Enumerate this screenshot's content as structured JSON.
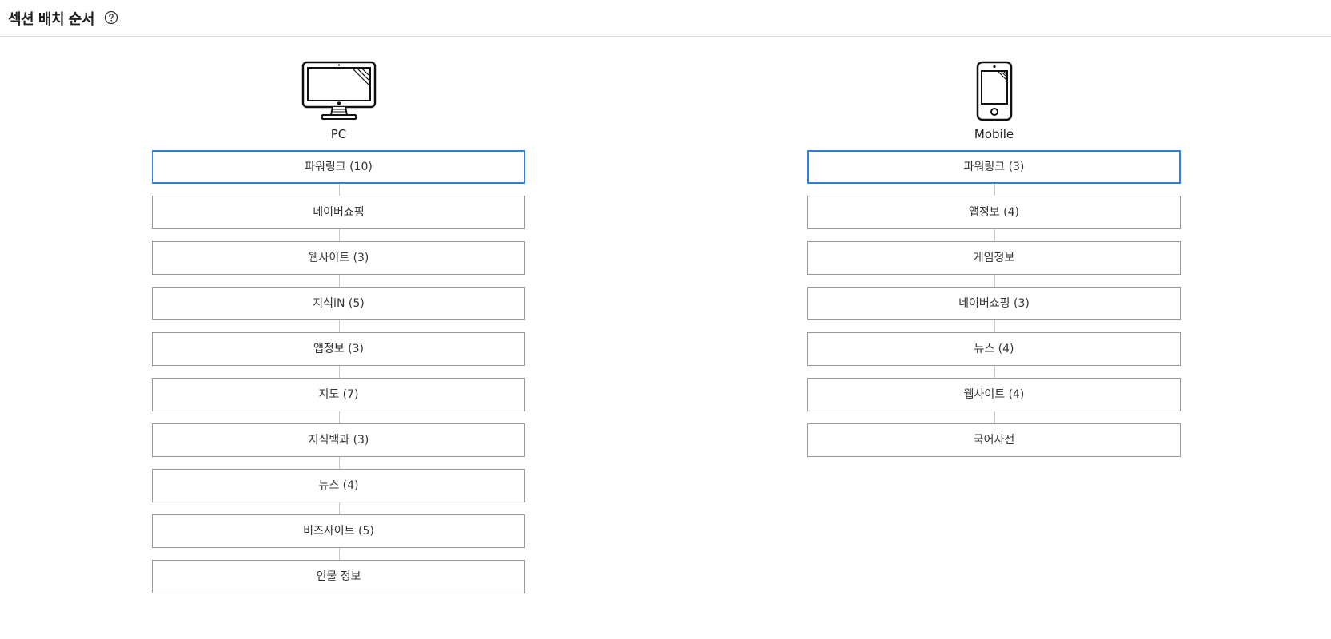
{
  "header": {
    "title": "섹션 배치 순서",
    "help_icon": "question-circle-icon"
  },
  "pc": {
    "label": "PC",
    "icon": "desktop-monitor-icon",
    "items": [
      {
        "label": "파워링크 (10)",
        "selected": true
      },
      {
        "label": "네이버쇼핑"
      },
      {
        "label": "웹사이트 (3)"
      },
      {
        "label": "지식iN (5)"
      },
      {
        "label": "앱정보 (3)"
      },
      {
        "label": "지도 (7)"
      },
      {
        "label": "지식백과 (3)"
      },
      {
        "label": "뉴스 (4)"
      },
      {
        "label": "비즈사이트 (5)"
      },
      {
        "label": "인물 정보"
      }
    ]
  },
  "mobile": {
    "label": "Mobile",
    "icon": "smartphone-icon",
    "items": [
      {
        "label": "파워링크 (3)",
        "selected": true
      },
      {
        "label": "앱정보 (4)"
      },
      {
        "label": "게임정보"
      },
      {
        "label": "네이버쇼핑 (3)"
      },
      {
        "label": "뉴스 (4)"
      },
      {
        "label": "웹사이트 (4)"
      },
      {
        "label": "국어사전"
      }
    ]
  },
  "colors": {
    "selected_border": "#2f7fe0",
    "item_border": "#9a9a9a",
    "connector": "#c8c8c8"
  }
}
